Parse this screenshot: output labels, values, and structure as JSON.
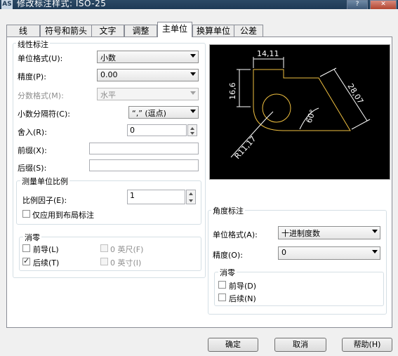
{
  "window": {
    "title": "修改标注样式: ISO-25",
    "app_icon": "AS"
  },
  "tabs": [
    {
      "label": "线",
      "active": false
    },
    {
      "label": "符号和箭头",
      "active": false
    },
    {
      "label": "文字",
      "active": false
    },
    {
      "label": "调整",
      "active": false
    },
    {
      "label": "主单位",
      "active": true
    },
    {
      "label": "换算单位",
      "active": false
    },
    {
      "label": "公差",
      "active": false
    }
  ],
  "linear": {
    "title": "线性标注",
    "unit_format": {
      "label": "单位格式(U):",
      "value": "小数"
    },
    "precision": {
      "label": "精度(P):",
      "value": "0.00"
    },
    "fraction_format": {
      "label": "分数格式(M):",
      "value": "水平"
    },
    "decimal_separator": {
      "label": "小数分隔符(C):",
      "value": "“,” (逗点)"
    },
    "round_off": {
      "label": "舍入(R):",
      "value": "0"
    },
    "prefix": {
      "label": "前缀(X):",
      "value": ""
    },
    "suffix": {
      "label": "后缀(S):",
      "value": ""
    },
    "scale": {
      "title": "测量单位比例",
      "factor_label": "比例因子(E):",
      "factor_value": "1",
      "layout_only_label": "仅应用到布局标注",
      "layout_only_checked": false
    },
    "zero": {
      "title": "消零",
      "leading": {
        "label": "前导(L)",
        "checked": false
      },
      "trailing": {
        "label": "后续(T)",
        "checked": true
      },
      "feet": {
        "label": "0 英尺(F)",
        "checked": false
      },
      "inches": {
        "label": "0 英寸(I)",
        "checked": false
      }
    }
  },
  "preview": {
    "dim_top": "14,11",
    "dim_left": "16,6",
    "dim_right": "28,07",
    "dim_angle": "60°",
    "dim_radius": "R11,17"
  },
  "angular": {
    "title": "角度标注",
    "unit_format": {
      "label": "单位格式(A):",
      "value": "十进制度数"
    },
    "precision": {
      "label": "精度(O):",
      "value": "0"
    },
    "zero": {
      "title": "消零",
      "leading": {
        "label": "前导(D)",
        "checked": false
      },
      "trailing": {
        "label": "后续(N)",
        "checked": false
      }
    }
  },
  "buttons": {
    "ok": "确定",
    "cancel": "取消",
    "help": "帮助(H)"
  },
  "colors": {
    "preview_bg": "#000000",
    "preview_lines": "#ffffff",
    "preview_geometry": "#f0c040"
  }
}
